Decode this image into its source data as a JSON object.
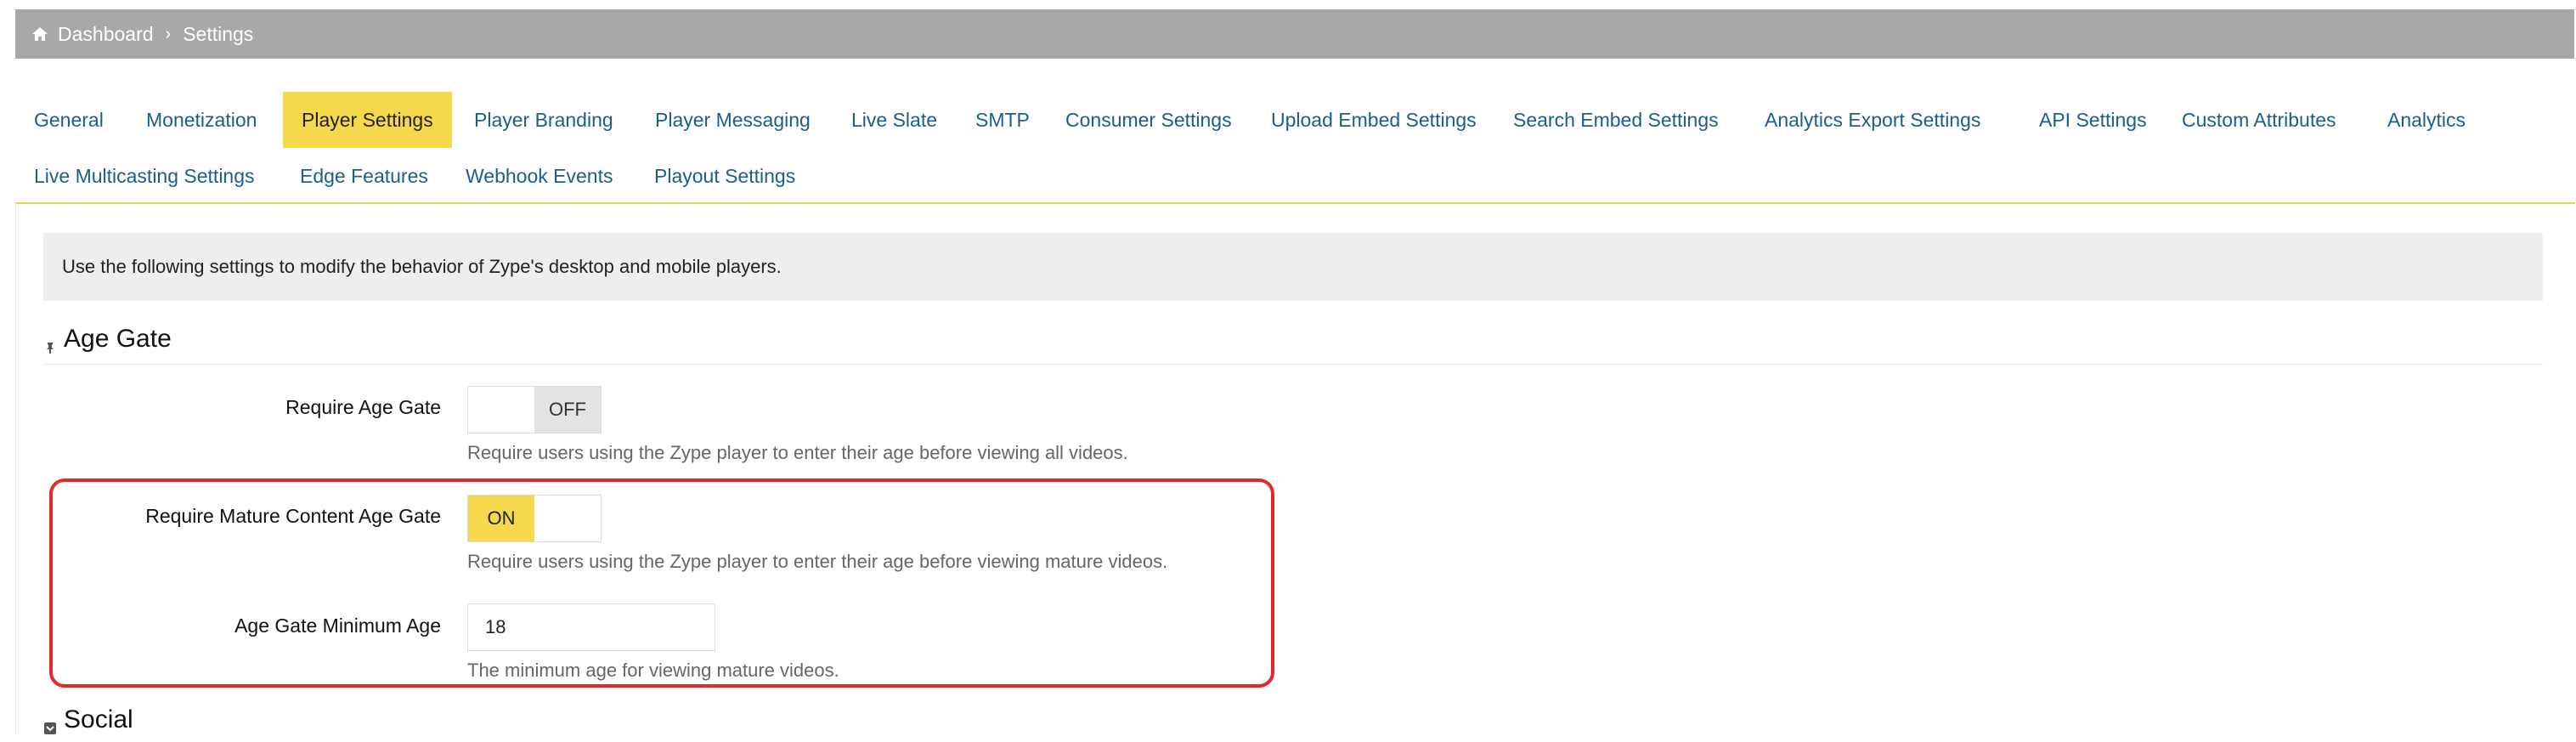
{
  "breadcrumb": {
    "home": "Dashboard",
    "separator": "›",
    "current": "Settings"
  },
  "tabs": [
    {
      "label": "General"
    },
    {
      "label": "Monetization"
    },
    {
      "label": "Player Settings",
      "active": true
    },
    {
      "label": "Player Branding"
    },
    {
      "label": "Player Messaging"
    },
    {
      "label": "Live Slate"
    },
    {
      "label": "SMTP"
    },
    {
      "label": "Consumer Settings"
    },
    {
      "label": "Upload Embed Settings"
    },
    {
      "label": "Search Embed Settings"
    },
    {
      "label": "Analytics Export Settings"
    },
    {
      "label": "API Settings"
    },
    {
      "label": "Custom Attributes"
    },
    {
      "label": "Analytics"
    },
    {
      "label": "Live Multicasting Settings"
    },
    {
      "label": "Edge Features"
    },
    {
      "label": "Webhook Events"
    },
    {
      "label": "Playout Settings"
    }
  ],
  "info_text": "Use the following settings to modify the behavior of Zype's desktop and mobile players.",
  "sections": {
    "age_gate": {
      "title": "Age Gate"
    },
    "social": {
      "title": "Social"
    }
  },
  "fields": {
    "require_age_gate": {
      "label": "Require Age Gate",
      "state": "OFF",
      "help": "Require users using the Zype player to enter their age before viewing all videos."
    },
    "require_mature_age_gate": {
      "label": "Require Mature Content Age Gate",
      "state": "ON",
      "help": "Require users using the Zype player to enter their age before viewing mature videos."
    },
    "age_gate_min_age": {
      "label": "Age Gate Minimum Age",
      "value": "18",
      "help": "The minimum age for viewing mature videos."
    }
  },
  "colors": {
    "accent": "#f5d84b",
    "link": "#1c5d8a",
    "highlight_border": "#e22a2a",
    "topbar": "#a8a8a8"
  },
  "icons": {
    "home": "home-icon",
    "age_gate": "pin-icon",
    "social": "social-square-icon"
  }
}
